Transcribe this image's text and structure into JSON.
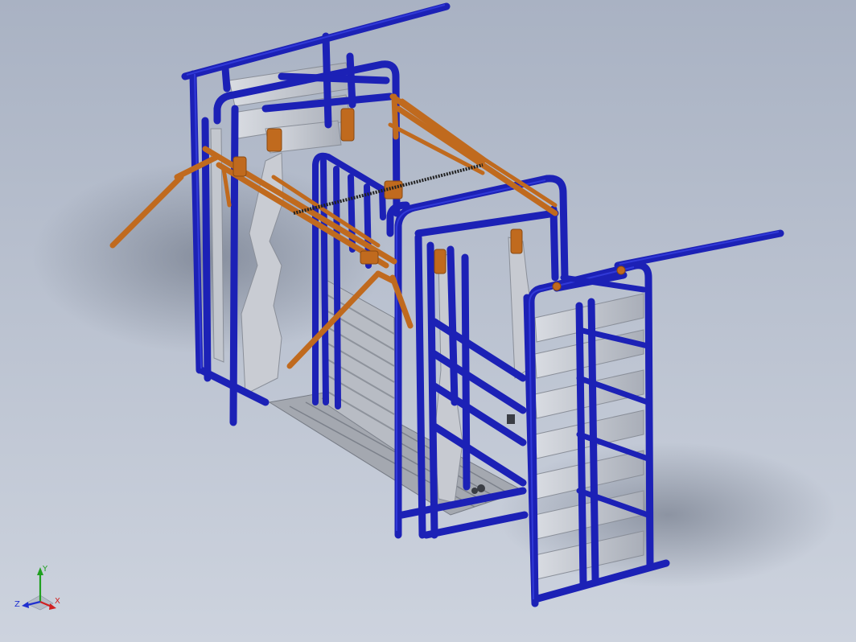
{
  "viewport": {
    "background_top": "#a9b2c3",
    "background_bottom": "#cdd3de"
  },
  "model": {
    "frame_color": "#1c21b6",
    "frame_highlight": "#3a44e6",
    "accessory_color": "#c06a1e",
    "panel_color": "#c8ccd4",
    "panel_shade": "#9aa0aa",
    "floor_color": "#a4a8b0"
  },
  "triad": {
    "x_label": "X",
    "y_label": "Y",
    "z_label": "Z",
    "x_color": "#d02020",
    "y_color": "#20a020",
    "z_color": "#2030d0"
  }
}
